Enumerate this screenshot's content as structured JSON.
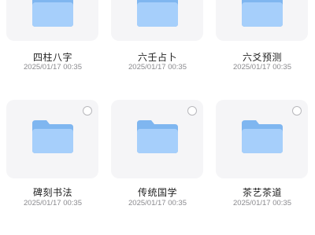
{
  "items": [
    {
      "name": "四柱八字",
      "date": "2025/01/17 00:35"
    },
    {
      "name": "六壬占卜",
      "date": "2025/01/17 00:35"
    },
    {
      "name": "六爻预测",
      "date": "2025/01/17 00:35"
    },
    {
      "name": "碑刻书法",
      "date": "2025/01/17 00:35"
    },
    {
      "name": "传统国学",
      "date": "2025/01/17 00:35"
    },
    {
      "name": "茶艺茶道",
      "date": "2025/01/17 00:35"
    }
  ],
  "colors": {
    "folder_back": "#7fb6f0",
    "folder_front": "#a6cffb",
    "tile_bg": "#f5f5f7"
  },
  "icons": {
    "folder": "folder-icon",
    "checkbox": "checkbox-circle-icon"
  }
}
